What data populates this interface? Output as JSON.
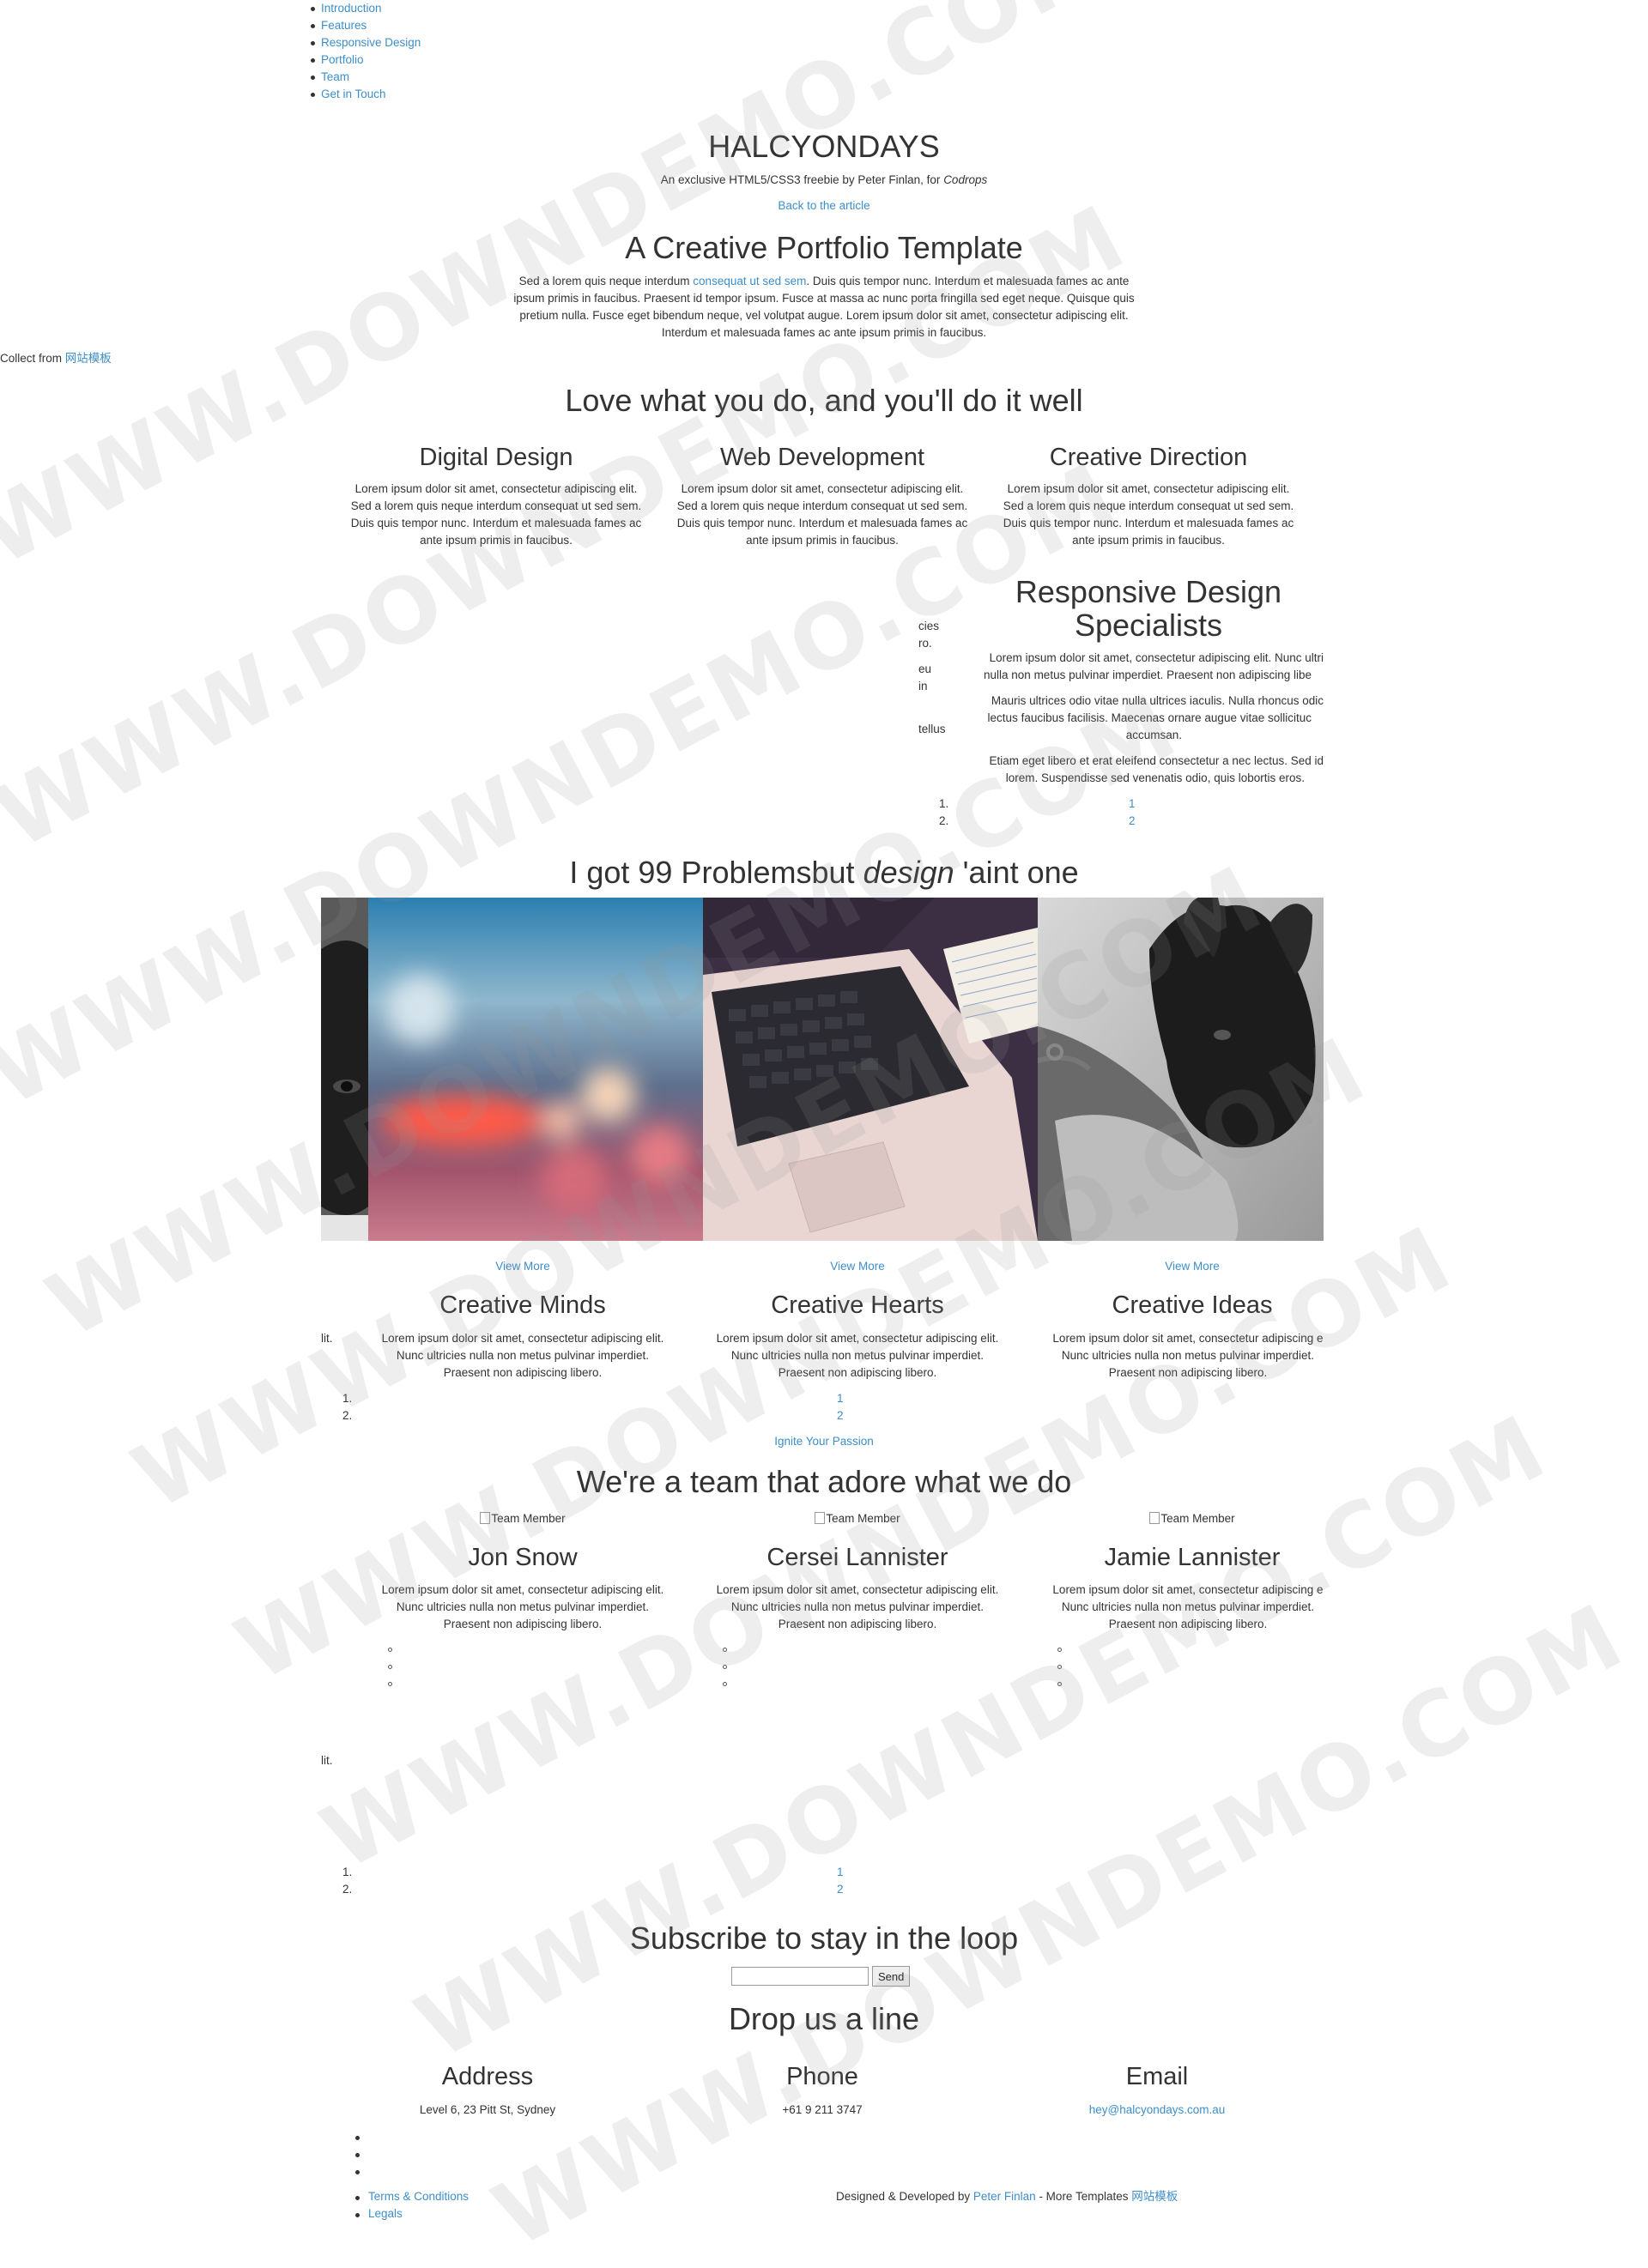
{
  "nav": [
    "Introduction",
    "Features",
    "Responsive Design",
    "Portfolio",
    "Team",
    "Get in Touch"
  ],
  "header": {
    "title": "HALCYONDAYS",
    "subtitle_prefix": "An exclusive HTML5/CSS3 freebie by Peter Finlan, for",
    "subtitle_em": "Codrops",
    "back_link": "Back to the article"
  },
  "collect": {
    "prefix": "Collect from",
    "link": "网站模板"
  },
  "intro": {
    "heading": "A Creative Portfolio Template",
    "text_before": "Sed a lorem quis neque interdum",
    "text_link": "consequat ut sed sem",
    "text_after": ". Duis quis tempor nunc. Interdum et malesuada fames ac ante ipsum primis in faucibus. Praesent id tempor ipsum. Fusce at massa ac nunc porta fringilla sed eget neque. Quisque quis pretium nulla. Fusce eget bibendum neque, vel volutpat augue. Lorem ipsum dolor sit amet, consectetur adipiscing elit. Interdum et malesuada fames ac ante ipsum primis in faucibus."
  },
  "features": {
    "heading": "Love what you do, and you'll do it well",
    "items": [
      {
        "title": "Digital Design",
        "text": "Lorem ipsum dolor sit amet, consectetur adipiscing elit. Sed a lorem quis neque interdum consequat ut sed sem. Duis quis tempor nunc. Interdum et malesuada fames ac ante ipsum primis in faucibus."
      },
      {
        "title": "Web Development",
        "text": "Lorem ipsum dolor sit amet, consectetur adipiscing elit. Sed a lorem quis neque interdum consequat ut sed sem. Duis quis tempor nunc. Interdum et malesuada fames ac ante ipsum primis in faucibus."
      },
      {
        "title": "Creative Direction",
        "text": "Lorem ipsum dolor sit amet, consectetur adipiscing elit. Sed a lorem quis neque interdum consequat ut sed sem. Duis quis tempor nunc. Interdum et malesuada fames ac ante ipsum primis in faucibus."
      }
    ]
  },
  "responsive": {
    "heading_line1": "Responsive Design",
    "heading_line2": "Specialists",
    "p1_line1": "Lorem ipsum dolor sit amet, consectetur adipiscing elit. Nunc ultri",
    "p1_line2": "nulla non metus pulvinar imperdiet. Praesent non adipiscing libe",
    "p2_line1": "Mauris ultrices odio vitae nulla ultrices iaculis. Nulla rhoncus odic",
    "p2_line2": "lectus faucibus facilisis. Maecenas ornare augue vitae sollicituc",
    "p2_line3": "accumsan.",
    "p3_line1": "Etiam eget libero et erat eleifend consectetur a nec lectus. Sed id",
    "p3_line2": "lorem. Suspendisse sed venenatis odio, quis lobortis eros.",
    "peek": [
      "cies",
      "ro.",
      "eu",
      "in",
      "tellus"
    ],
    "list_markers": [
      "1.",
      "2."
    ],
    "pager": [
      "1",
      "2"
    ]
  },
  "portfolio": {
    "heading_before": "I got 99 Problemsbut",
    "heading_em": "design",
    "heading_after": "'aint one",
    "view_more": [
      "View More",
      "View More",
      "View More"
    ],
    "items": [
      {
        "title": "Creative Minds",
        "text": "Lorem ipsum dolor sit amet, consectetur adipiscing elit. Nunc ultricies nulla non metus pulvinar imperdiet. Praesent non adipiscing libero."
      },
      {
        "title": "Creative Hearts",
        "text": "Lorem ipsum dolor sit amet, consectetur adipiscing elit. Nunc ultricies nulla non metus pulvinar imperdiet. Praesent non adipiscing libero."
      },
      {
        "title": "Creative Ideas",
        "text": "Lorem ipsum dolor sit amet, consectetur adipiscing e Nunc ultricies nulla non metus pulvinar imperdiet. Praesent non adipiscing libero."
      }
    ],
    "peek": "lit.",
    "list_markers": [
      "1.",
      "2."
    ],
    "pager": [
      "1",
      "2"
    ],
    "cta": "Ignite Your Passion"
  },
  "team": {
    "heading": "We're a team that adore what we do",
    "img_alt": "Team Member",
    "members": [
      {
        "name": "Jon Snow",
        "text": "Lorem ipsum dolor sit amet, consectetur adipiscing elit. Nunc ultricies nulla non metus pulvinar imperdiet. Praesent non adipiscing libero."
      },
      {
        "name": "Cersei Lannister",
        "text": "Lorem ipsum dolor sit amet, consectetur adipiscing elit. Nunc ultricies nulla non metus pulvinar imperdiet. Praesent non adipiscing libero."
      },
      {
        "name": "Jamie Lannister",
        "text": "Lorem ipsum dolor sit amet, consectetur adipiscing e Nunc ultricies nulla non metus pulvinar imperdiet. Praesent non adipiscing libero."
      }
    ],
    "peek": "lit.",
    "list_markers": [
      "1.",
      "2."
    ],
    "pager": [
      "1",
      "2"
    ]
  },
  "subscribe": {
    "heading": "Subscribe to stay in the loop",
    "placeholder": "",
    "button": "Send"
  },
  "contact": {
    "heading": "Drop us a line",
    "address_title": "Address",
    "address": "Level 6, 23 Pitt St, Sydney",
    "phone_title": "Phone",
    "phone": "+61 9 211 3747",
    "email_title": "Email",
    "email": "hey@halcyondays.com.au"
  },
  "footer": {
    "links": [
      "Terms & Conditions",
      "Legals"
    ],
    "credit_prefix": "Designed & Developed by",
    "credit_link": "Peter Finlan",
    "credit_mid": "- More Templates",
    "credit_link2": "网站模板"
  },
  "watermark": "WWW.DOWNDEMO.COM",
  "colors": {
    "link": "#3d8ec9",
    "text": "#333333"
  }
}
